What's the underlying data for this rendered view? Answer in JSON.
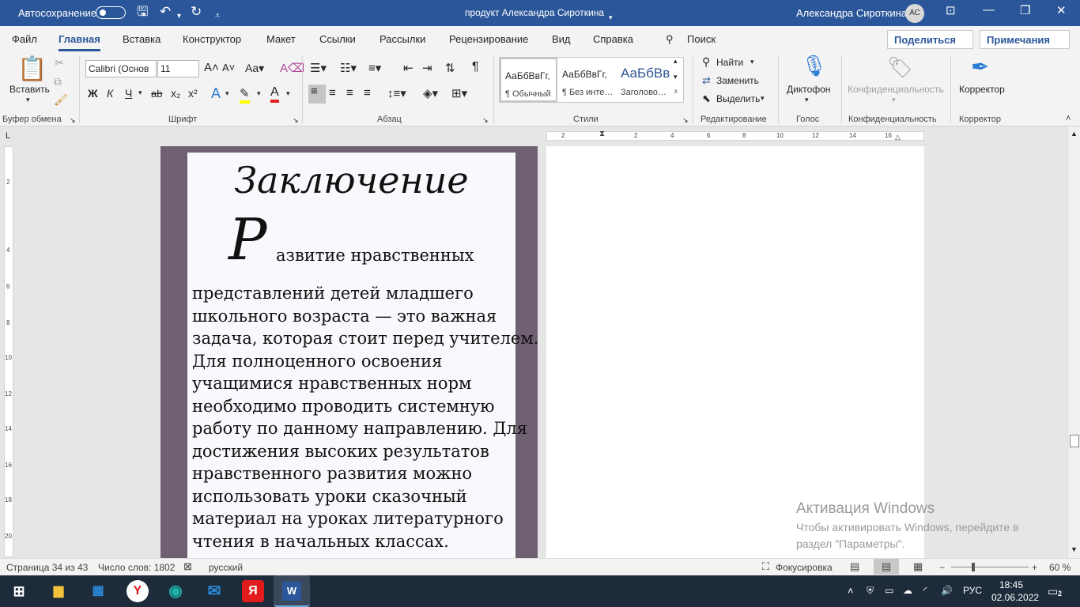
{
  "titlebar": {
    "autosave_label": "Автосохранение",
    "doc_title": "продукт Александра Сироткина",
    "user_name": "Александра Сироткина",
    "user_initials": "АС"
  },
  "tabs": [
    "Файл",
    "Главная",
    "Вставка",
    "Конструктор",
    "Макет",
    "Ссылки",
    "Рассылки",
    "Рецензирование",
    "Вид",
    "Справка"
  ],
  "active_tab": "Главная",
  "search_label": "Поиск",
  "share_label": "Поделиться",
  "notes_label": "Примечания",
  "ribbon": {
    "clipboard": {
      "paste": "Вставить",
      "group": "Буфер обмена"
    },
    "font": {
      "name": "Calibri (Основ",
      "size": "11",
      "group": "Шрифт",
      "bold": "Ж",
      "italic": "К",
      "underline": "Ч",
      "strike": "ab",
      "sub": "x₂",
      "sup": "x²"
    },
    "paragraph": {
      "group": "Абзац",
      "pilcrow": "¶"
    },
    "styles": {
      "group": "Стили",
      "items": [
        {
          "sample": "АаБбВвГг,",
          "name": "¶ Обычный"
        },
        {
          "sample": "АаБбВвГг,",
          "name": "¶ Без инте…"
        },
        {
          "sample": "АаБбВв",
          "name": "Заголово…"
        }
      ]
    },
    "editing": {
      "find": "Найти",
      "replace": "Заменить",
      "select": "Выделить",
      "group": "Редактирование"
    },
    "voice": {
      "dictate": "Диктофон",
      "group": "Голос"
    },
    "sensitivity": {
      "label": "Конфиденциальность",
      "group": "Конфиденциальность"
    },
    "editor": {
      "label": "Корректор",
      "group": "Корректор"
    }
  },
  "ruler": {
    "horizontal": [
      "2",
      "2",
      "4",
      "6",
      "8",
      "10",
      "12",
      "14",
      "16"
    ],
    "vertical": [
      "2",
      "4",
      "6",
      "8",
      "10",
      "12",
      "14",
      "16",
      "18",
      "20"
    ]
  },
  "document": {
    "heading": "Заключение",
    "dropcap": "Р",
    "first_line": "азвитие нравственных",
    "lines": [
      "представлений детей младшего",
      "школьного возраста — это важная",
      "задача, которая стоит перед учителем.",
      "Для полноценного освоения",
      "учащимися нравственных норм",
      "необходимо проводить системную",
      "работу по данному направлению. Для",
      "достижения высоких результатов",
      "нравственного развития можно",
      "использовать уроки сказочный",
      "материал на уроках литературного",
      "чтения в начальных классах."
    ]
  },
  "watermark": {
    "title": "Активация Windows",
    "text": "Чтобы активировать Windows, перейдите в раздел \"Параметры\"."
  },
  "statusbar": {
    "page": "Страница 34 из 43",
    "words": "Число слов: 1802",
    "language": "русский",
    "focus": "Фокусировка",
    "zoom": "60 %"
  },
  "taskbar": {
    "language": "РУС",
    "time": "18:45",
    "date": "02.06.2022",
    "notifications": "2"
  },
  "colors": {
    "accent": "#2b579a",
    "page_border": "#6e6070",
    "taskbar": "#1d2b3a"
  }
}
